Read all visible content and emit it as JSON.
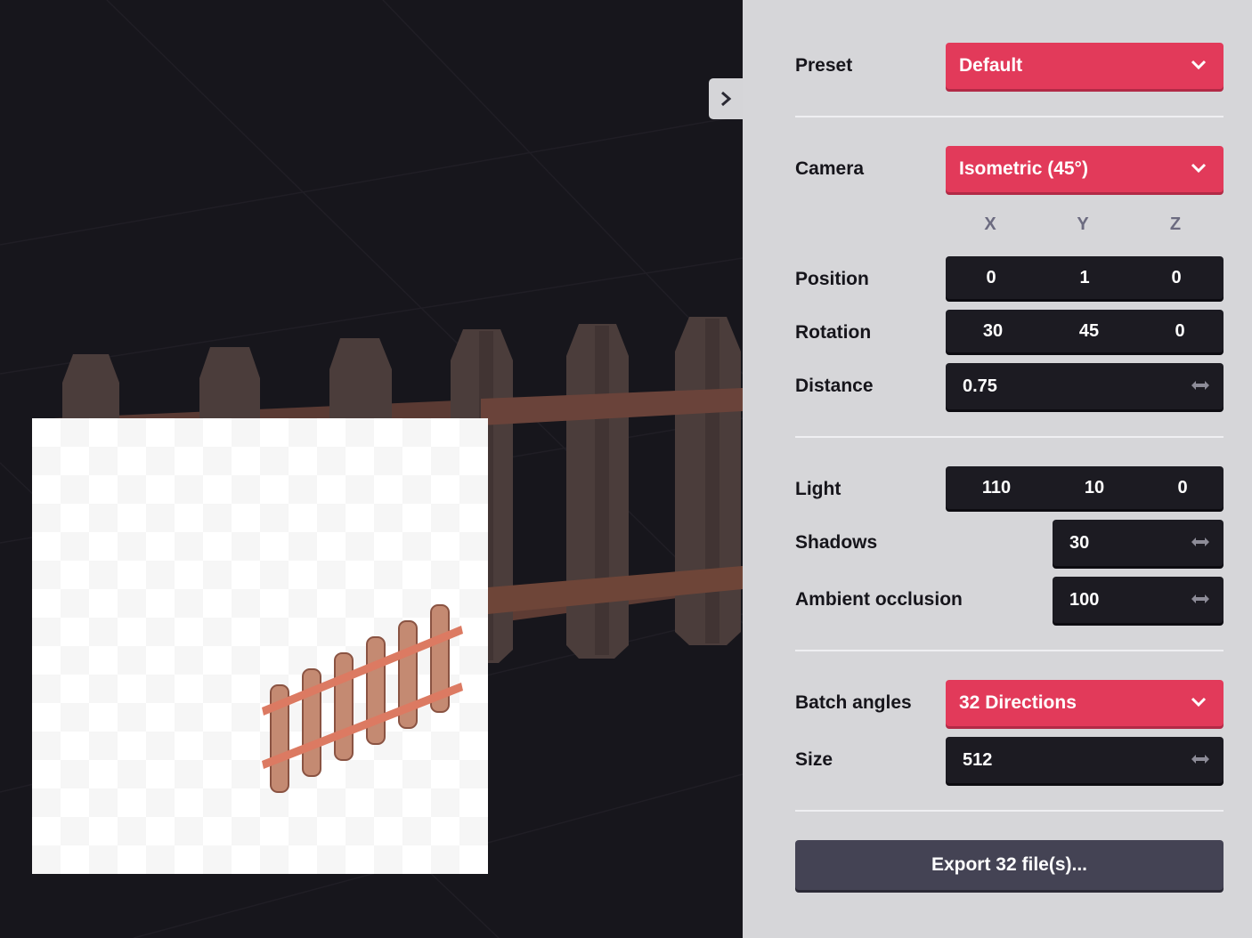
{
  "panel": {
    "preset": {
      "label": "Preset",
      "value": "Default"
    },
    "camera": {
      "label": "Camera",
      "value": "Isometric (45°)"
    },
    "axes": [
      "X",
      "Y",
      "Z"
    ],
    "position": {
      "label": "Position",
      "x": "0",
      "y": "1",
      "z": "0"
    },
    "rotation": {
      "label": "Rotation",
      "x": "30",
      "y": "45",
      "z": "0"
    },
    "distance": {
      "label": "Distance",
      "value": "0.75"
    },
    "light": {
      "label": "Light",
      "x": "110",
      "y": "10",
      "z": "0"
    },
    "shadows": {
      "label": "Shadows",
      "value": "30"
    },
    "ambient_occlusion": {
      "label": "Ambient occlusion",
      "value": "100"
    },
    "batch_angles": {
      "label": "Batch angles",
      "value": "32 Directions"
    },
    "size": {
      "label": "Size",
      "value": "512"
    },
    "export_label": "Export 32 file(s)..."
  },
  "colors": {
    "accent": "#e23a5a",
    "field_bg": "#1c1b22",
    "panel_bg": "#d6d6d9",
    "viewport_bg": "#17161c",
    "button_bg": "#444354"
  },
  "icons": {
    "toggle": "chevron-right-icon",
    "dropdown": "chevron-down-icon",
    "drag": "horizontal-arrows-icon"
  }
}
